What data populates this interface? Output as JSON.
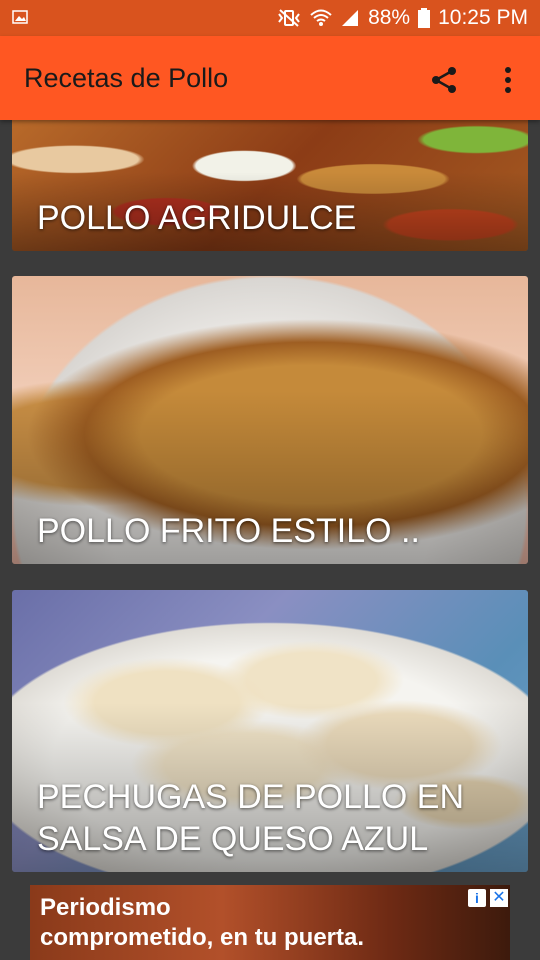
{
  "status_bar": {
    "gallery_icon": "image-icon",
    "mute_icon": "vibrate-mute-icon",
    "wifi_icon": "wifi-icon",
    "signal_icon": "signal-icon",
    "battery_percent": "88%",
    "battery_icon": "battery-icon",
    "time": "10:25 PM"
  },
  "app_bar": {
    "title": "Recetas de Pollo",
    "share_icon": "share-icon",
    "more_icon": "more-vert-icon",
    "color": "#ff5722"
  },
  "recipes": [
    {
      "title": "POLLO AGRIDULCE"
    },
    {
      "title": "POLLO FRITO ESTILO .."
    },
    {
      "title": "PECHUGAS DE POLLO EN SALSA DE QUESO AZUL"
    }
  ],
  "ad": {
    "text_line1": "Periodismo",
    "text_line2": "comprometido, en tu puerta.",
    "info_label": "i",
    "close_label": "✕"
  }
}
